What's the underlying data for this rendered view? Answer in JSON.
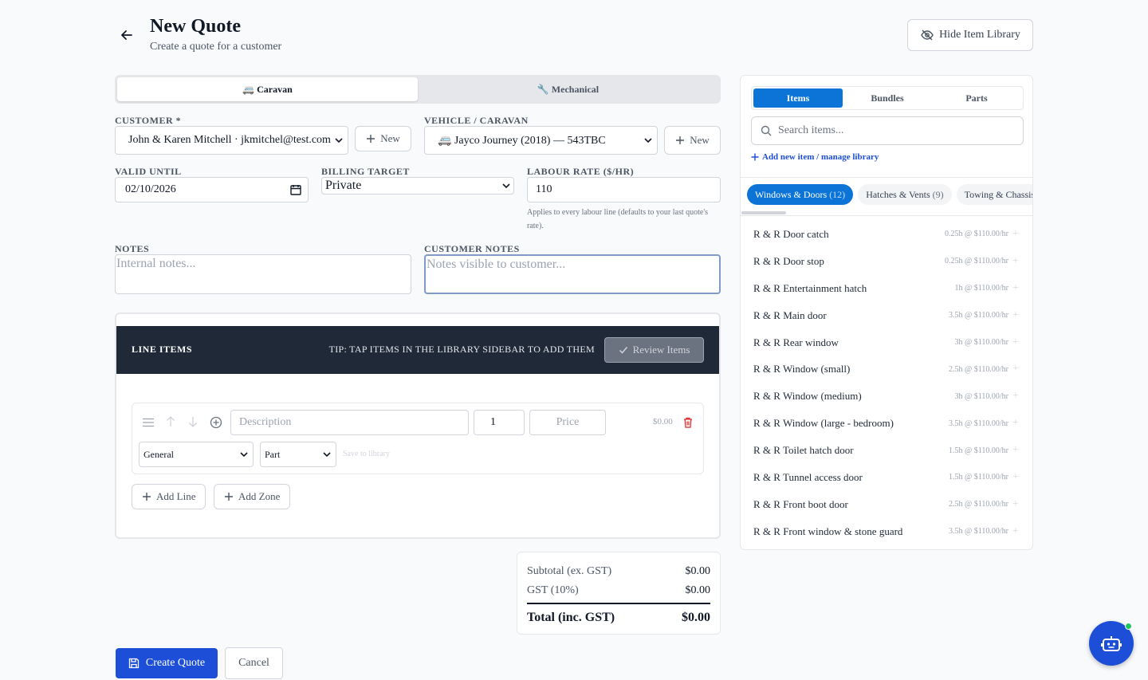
{
  "header": {
    "title": "New Quote",
    "subtitle": "Create a quote for a customer",
    "hide_library_label": "Hide Item Library"
  },
  "quote_type_tabs": [
    {
      "label": "🚐 Caravan",
      "active": true
    },
    {
      "label": "🔧 Mechanical",
      "active": false
    }
  ],
  "form": {
    "customer_label": "CUSTOMER *",
    "customer_value": "John & Karen Mitchell · jkmitchel@test.com",
    "customer_new_label": "New",
    "vehicle_label": "VEHICLE / CARAVAN",
    "vehicle_value": "🚐 Jayco Journey (2018) — 543TBC",
    "vehicle_new_label": "New",
    "valid_until_label": "VALID UNTIL",
    "valid_until_value": "02/10/2026",
    "billing_target_label": "BILLING TARGET",
    "billing_target_value": "Private",
    "labour_rate_label": "LABOUR RATE ($/HR)",
    "labour_rate_value": "110",
    "labour_rate_hint": "Applies to every labour line (defaults to your last quote's rate).",
    "notes_label": "NOTES",
    "notes_placeholder": "Internal notes...",
    "customer_notes_label": "CUSTOMER NOTES",
    "customer_notes_placeholder": "Notes visible to customer..."
  },
  "line_items": {
    "title": "LINE ITEMS",
    "tip": "TIP: TAP ITEMS IN THE LIBRARY SIDEBAR TO ADD THEM",
    "review_label": "Review Items",
    "row": {
      "description_placeholder": "Description",
      "quantity": "1",
      "price_placeholder": "Price",
      "amount": "$0.00",
      "category": "General",
      "type": "Part",
      "save_to_library": "Save to library"
    },
    "add_line_label": "Add Line",
    "add_zone_label": "Add Zone"
  },
  "totals": {
    "subtotal_label": "Subtotal (ex. GST)",
    "subtotal_value": "$0.00",
    "gst_label": "GST (10%)",
    "gst_value": "$0.00",
    "total_label": "Total (inc. GST)",
    "total_value": "$0.00"
  },
  "actions": {
    "create_label": "Create Quote",
    "cancel_label": "Cancel"
  },
  "library": {
    "tabs": [
      {
        "label": "Items",
        "active": true
      },
      {
        "label": "Bundles",
        "active": false
      },
      {
        "label": "Parts",
        "active": false
      }
    ],
    "search_placeholder": "Search items...",
    "add_link": "Add new item / manage library",
    "chips": [
      {
        "label": "Windows & Doors",
        "count": "(12)",
        "active": true
      },
      {
        "label": "Hatches & Vents",
        "count": "(9)",
        "active": false
      },
      {
        "label": "Towing & Chassis",
        "count": "",
        "active": false
      }
    ],
    "items": [
      {
        "name": "R & R Door catch",
        "rate": "0.25h @ $110.00/hr"
      },
      {
        "name": "R & R Door stop",
        "rate": "0.25h @ $110.00/hr"
      },
      {
        "name": "R & R Entertainment hatch",
        "rate": "1h @ $110.00/hr"
      },
      {
        "name": "R & R Main door",
        "rate": "3.5h @ $110.00/hr"
      },
      {
        "name": "R & R Rear window",
        "rate": "3h @ $110.00/hr"
      },
      {
        "name": "R & R Window (small)",
        "rate": "2.5h @ $110.00/hr"
      },
      {
        "name": "R & R Window (medium)",
        "rate": "3h @ $110.00/hr"
      },
      {
        "name": "R & R Window (large - bedroom)",
        "rate": "3.5h @ $110.00/hr"
      },
      {
        "name": "R & R Toilet hatch door",
        "rate": "1.5h @ $110.00/hr"
      },
      {
        "name": "R & R Tunnel access door",
        "rate": "1.5h @ $110.00/hr"
      },
      {
        "name": "R & R Front boot door",
        "rate": "2.5h @ $110.00/hr"
      },
      {
        "name": "R & R Front window & stone guard",
        "rate": "3.5h @ $110.00/hr"
      }
    ]
  },
  "colors": {
    "primary": "#1d4ed8",
    "library_active": "#0b74d6",
    "header_dark": "#1f2937",
    "delete_red": "#dc2626",
    "status_online": "#22c55e"
  },
  "icons": [
    "arrow-left-icon",
    "eye-off-icon",
    "plus-icon",
    "search-icon",
    "drag-handle-icon",
    "arrow-up-icon",
    "arrow-down-icon",
    "plus-circle-icon",
    "trash-icon",
    "check-icon",
    "save-icon",
    "bot-icon"
  ]
}
